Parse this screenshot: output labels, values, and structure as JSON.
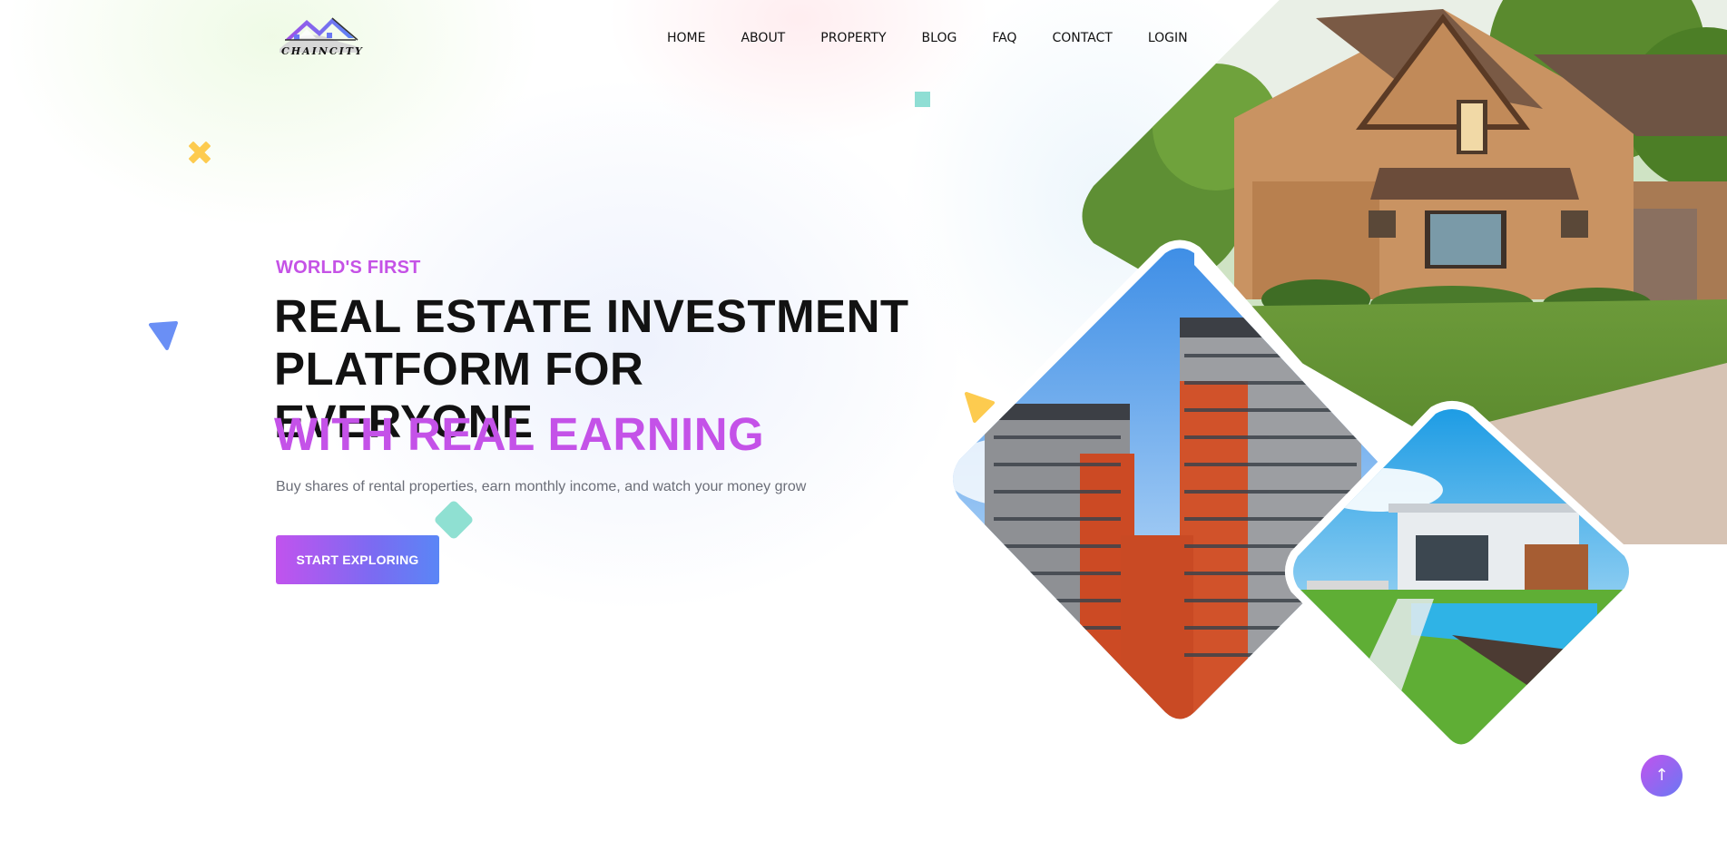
{
  "brand": {
    "name": "Chaincity",
    "logo_text": "CHAINCITY"
  },
  "nav": {
    "items": [
      {
        "label": "HOME"
      },
      {
        "label": "ABOUT"
      },
      {
        "label": "PROPERTY"
      },
      {
        "label": "BLOG"
      },
      {
        "label": "FAQ"
      },
      {
        "label": "CONTACT"
      },
      {
        "label": "LOGIN"
      }
    ]
  },
  "hero": {
    "eyebrow": "WORLD'S FIRST",
    "headline_line1": "REAL ESTATE INVESTMENT",
    "headline_line2": "PLATFORM FOR EVERYONE",
    "headline_accent": "WITH REAL EARNING",
    "subtitle": "Buy shares of rental properties, earn monthly income, and watch your money grow",
    "cta_label": "START EXPLORING"
  },
  "scroll_top": {
    "icon": "arrow-up-icon",
    "glyph": "↑"
  },
  "colors": {
    "accent_purple": "#c452e8",
    "accent_blue": "#5a86f6",
    "teal": "#8fe0d2",
    "yellow": "#fdcb4f",
    "dark_text": "#121212"
  }
}
